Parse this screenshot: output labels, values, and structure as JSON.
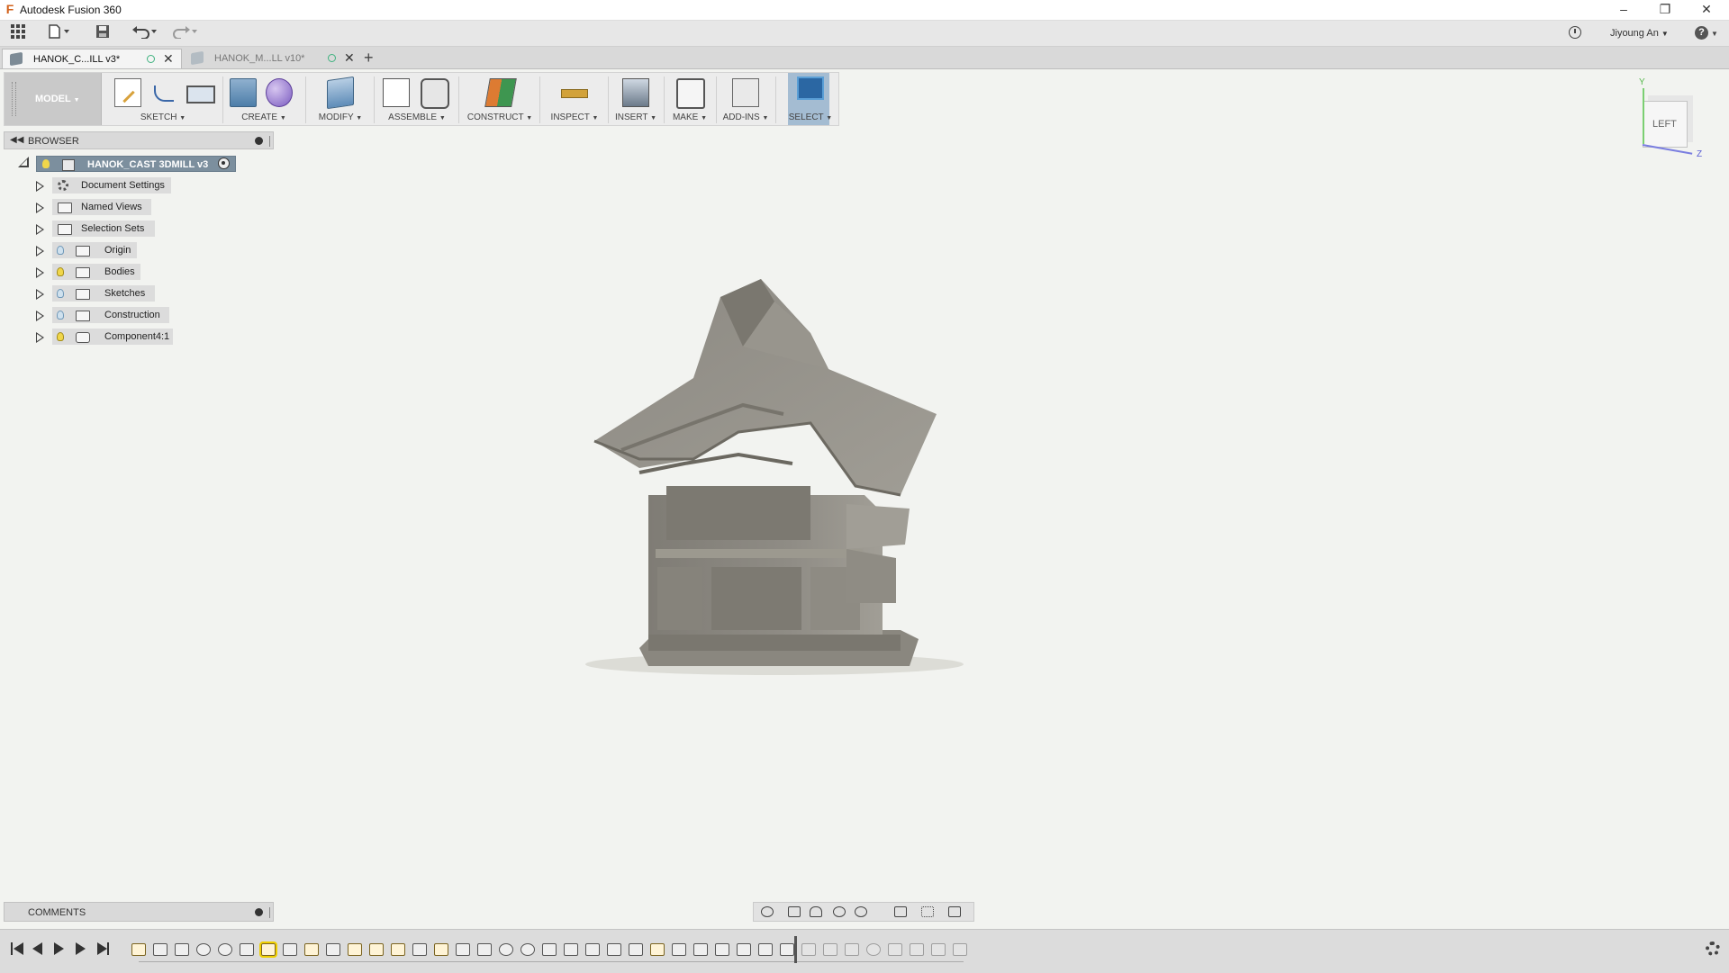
{
  "window": {
    "title": "Autodesk Fusion 360",
    "controls": [
      "minimize",
      "restore",
      "close"
    ]
  },
  "quick_access": {
    "icons": [
      "data-panel-icon",
      "file-icon",
      "save-icon",
      "undo-icon",
      "redo-icon"
    ],
    "user_name": "Jiyoung An",
    "help_label": "?"
  },
  "tabs": [
    {
      "label": "HANOK_C...ILL v3*",
      "active": true
    },
    {
      "label": "HANOK_M...LL v10*",
      "active": false
    }
  ],
  "ribbon": {
    "workspace": "MODEL",
    "groups": [
      {
        "label": "SKETCH"
      },
      {
        "label": "CREATE"
      },
      {
        "label": "MODIFY"
      },
      {
        "label": "ASSEMBLE"
      },
      {
        "label": "CONSTRUCT"
      },
      {
        "label": "INSPECT"
      },
      {
        "label": "INSERT"
      },
      {
        "label": "MAKE"
      },
      {
        "label": "ADD-INS"
      },
      {
        "label": "SELECT"
      }
    ]
  },
  "browser": {
    "title": "BROWSER",
    "root": "HANOK_CAST 3DMILL v3",
    "items": [
      {
        "label": "Document Settings",
        "icon": "gear-icon",
        "bulb": false
      },
      {
        "label": "Named Views",
        "icon": "folder-icon",
        "bulb": false
      },
      {
        "label": "Selection Sets",
        "icon": "folder-icon",
        "bulb": false
      },
      {
        "label": "Origin",
        "icon": "folder-icon",
        "bulb": "off"
      },
      {
        "label": "Bodies",
        "icon": "folder-icon",
        "bulb": "on"
      },
      {
        "label": "Sketches",
        "icon": "folder-icon",
        "bulb": "off"
      },
      {
        "label": "Construction",
        "icon": "folder-icon",
        "bulb": "off"
      },
      {
        "label": "Component4:1",
        "icon": "component-icon",
        "bulb": "on"
      }
    ]
  },
  "viewcube": {
    "face": "LEFT",
    "axis_y": "Y",
    "axis_z": "Z",
    "colors": {
      "y": "#59b84f",
      "z": "#5a5fd4"
    }
  },
  "comments": {
    "title": "COMMENTS"
  },
  "colors": {
    "viewport_bg": "#f2f3f0",
    "model": "#8d8a82",
    "ribbon_bg": "#ececec",
    "browser_root": "#7c8f9e",
    "select_active": "#a4bcd2"
  }
}
